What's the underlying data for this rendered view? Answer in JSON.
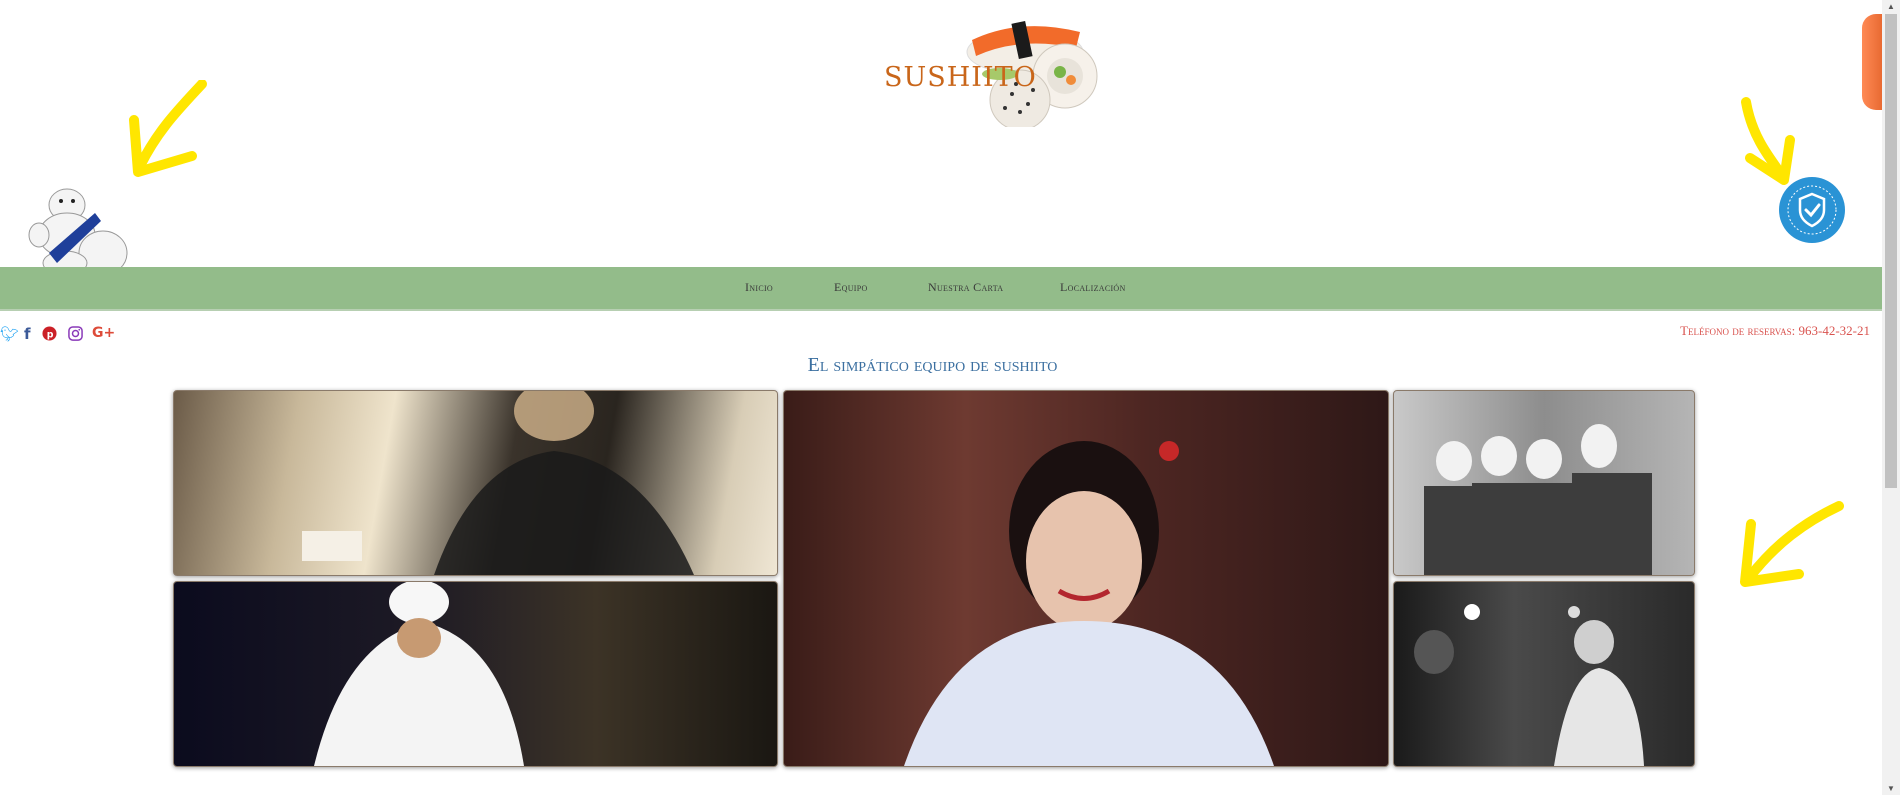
{
  "brand": {
    "logo_text": "SUSHIITO"
  },
  "nav": {
    "items": [
      {
        "label": "Inicio"
      },
      {
        "label": "Equipo"
      },
      {
        "label": "Nuestra Carta"
      },
      {
        "label": "Localización"
      }
    ]
  },
  "social": {
    "icons": [
      "twitter-icon",
      "facebook-icon",
      "pinterest-icon",
      "instagram-icon",
      "google-plus-icon"
    ],
    "colors": {
      "twitter": "#1da1f2",
      "facebook": "#3b5998",
      "pinterest": "#cb2027",
      "instagram": "#8a3ab9",
      "google_plus": "#dd4b39"
    }
  },
  "reservation": {
    "label": "Teléfono de reservas: 963-42-32-21"
  },
  "team": {
    "title": "El simpático equipo de sushiito"
  },
  "colors": {
    "nav_bg": "#93bc8a",
    "accent_arrow": "#ffe600",
    "logo_text": "#c9661a",
    "phone": "#d9534f",
    "title": "#3b6fa0"
  }
}
